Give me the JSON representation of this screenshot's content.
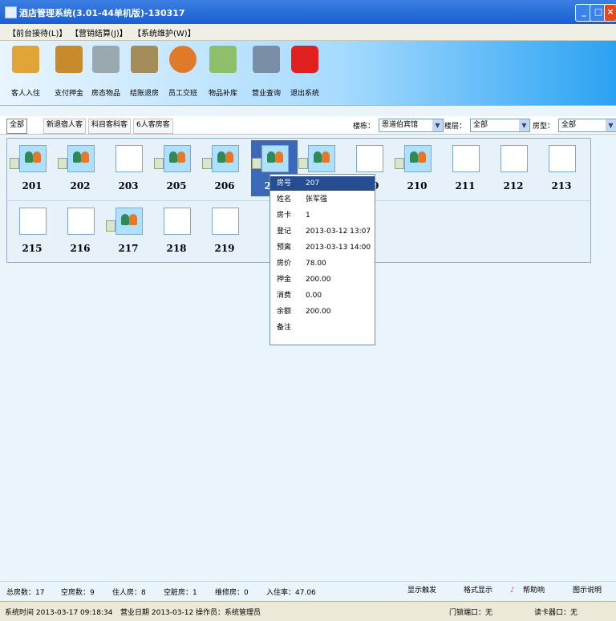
{
  "window": {
    "title": "酒店管理系统(3.01-44单机版)-130317"
  },
  "menu": {
    "items": [
      "【前台接待(L)】",
      "【营销结算(J)】",
      "【系统维护(W)】"
    ]
  },
  "toolbar": {
    "buttons": [
      {
        "label": "客人入住",
        "icon": "guest-checkin-icon",
        "color": "#e0a437"
      },
      {
        "label": "支付押金",
        "icon": "deposit-icon",
        "color": "#c78b2e"
      },
      {
        "label": "房态物品",
        "icon": "room-items-icon",
        "color": "#9aa8b0"
      },
      {
        "label": "结账退房",
        "icon": "checkout-icon",
        "color": "#a58d5b"
      },
      {
        "label": "员工交班",
        "icon": "shift-handover-icon",
        "color": "#e07a2b"
      },
      {
        "label": "物品补库",
        "icon": "stock-icon",
        "color": "#8fbf6a"
      },
      {
        "label": "营业查询",
        "icon": "query-icon",
        "color": "#7a8fa5"
      },
      {
        "label": "退出系统",
        "icon": "exit-icon",
        "color": "#e11f1f"
      }
    ]
  },
  "filter": {
    "tabs": [
      "全部",
      "新退宿人客",
      "科目客科客",
      "6人客房客"
    ],
    "building_label": "楼栋：",
    "building_value": "恩道伯宾馆",
    "floor_label": "楼层：",
    "floor_value": "全部",
    "roomtype_label": "房型：",
    "roomtype_value": "全部"
  },
  "rooms": [
    {
      "number": "201",
      "occupied": true
    },
    {
      "number": "202",
      "occupied": true
    },
    {
      "number": "203",
      "occupied": false
    },
    {
      "number": "205",
      "occupied": true
    },
    {
      "number": "206",
      "occupied": true
    },
    {
      "number": "207",
      "occupied": true,
      "selected": true
    },
    {
      "number": "208",
      "occupied": true
    },
    {
      "number": "209",
      "occupied": false
    },
    {
      "number": "210",
      "occupied": true
    },
    {
      "number": "211",
      "occupied": false
    },
    {
      "number": "212",
      "occupied": false
    },
    {
      "number": "213",
      "occupied": false
    },
    {
      "number": "215",
      "occupied": false
    },
    {
      "number": "216",
      "occupied": false
    },
    {
      "number": "217",
      "occupied": true
    },
    {
      "number": "218",
      "occupied": false
    },
    {
      "number": "219",
      "occupied": false
    }
  ],
  "tooltip": {
    "rows": [
      {
        "k": "房号",
        "v": "207"
      },
      {
        "k": "姓名",
        "v": "张军强"
      },
      {
        "k": "房卡",
        "v": "1"
      },
      {
        "k": "登记",
        "v": "2013-03-12 13:07"
      },
      {
        "k": "预离",
        "v": "2013-03-13 14:00"
      },
      {
        "k": "房价",
        "v": "78.00"
      },
      {
        "k": "押金",
        "v": "200.00"
      },
      {
        "k": "消费",
        "v": "0.00"
      },
      {
        "k": "余额",
        "v": "200.00"
      },
      {
        "k": "备注",
        "v": ""
      }
    ]
  },
  "status": {
    "total": "总房数：17",
    "vacant": "空房数：9",
    "occupied": "住人房：8",
    "dirty": "空脏房：1",
    "repair": "维修房：0",
    "rate": "入住率：47.06",
    "buttons": [
      "显示触发",
      "格式显示",
      "帮助响",
      "图示说明"
    ]
  },
  "bottom": {
    "login": "系统时间 2013-03-17 09:18:34",
    "business_date": "营业日期 2013-03-12",
    "operator": "操作员：系统管理员",
    "door_port": "门锁端口：无",
    "card_port": "读卡器口：无"
  }
}
